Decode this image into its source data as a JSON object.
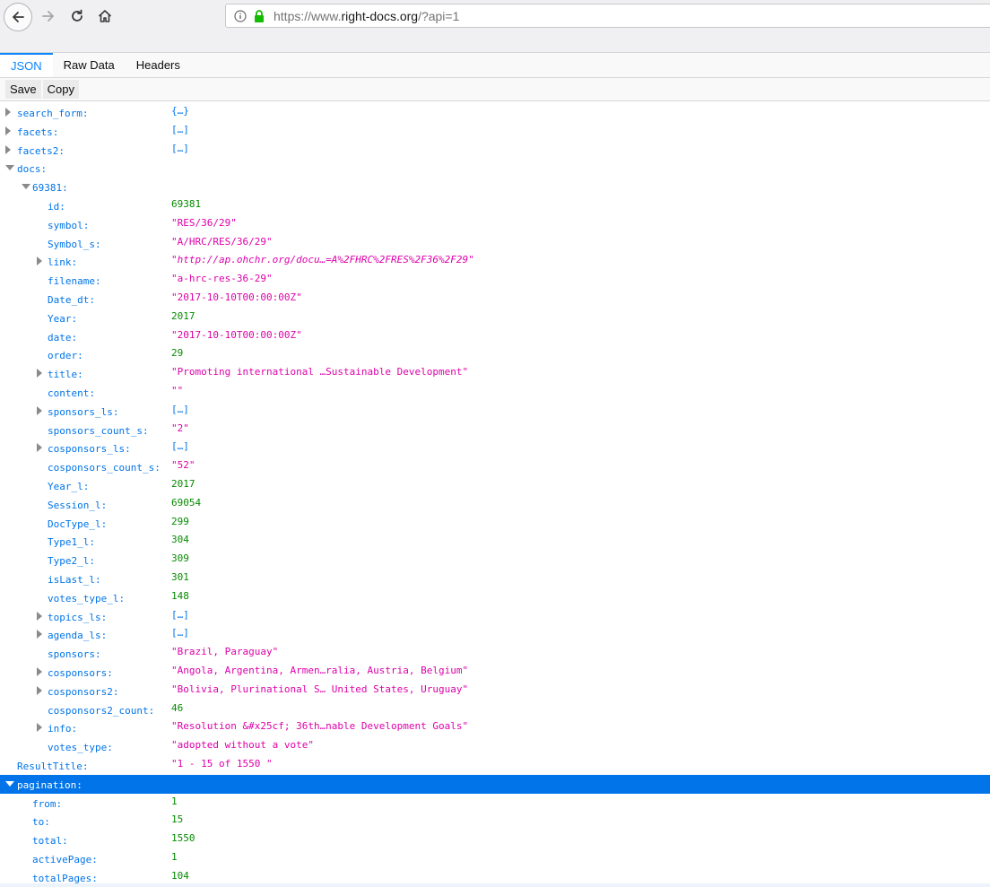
{
  "browser": {
    "url_prefix": "https://www.",
    "url_host": "right-docs.org",
    "url_suffix": "/?api=1"
  },
  "viewer": {
    "tabs": [
      "JSON",
      "Raw Data",
      "Headers"
    ],
    "active_tab": "JSON",
    "save_label": "Save",
    "copy_label": "Copy"
  },
  "tree": [
    {
      "key": "search_form:",
      "value": "{…}",
      "type": "obj",
      "indent": 0,
      "expander": "closed"
    },
    {
      "key": "facets:",
      "value": "[…]",
      "type": "obj",
      "indent": 0,
      "expander": "closed"
    },
    {
      "key": "facets2:",
      "value": "[…]",
      "type": "obj",
      "indent": 0,
      "expander": "closed"
    },
    {
      "key": "docs:",
      "value": "",
      "type": "obj",
      "indent": 0,
      "expander": "open"
    },
    {
      "key": "69381:",
      "value": "",
      "type": "obj",
      "indent": 1,
      "expander": "open"
    },
    {
      "key": "id:",
      "value": "69381",
      "type": "num",
      "indent": 2,
      "expander": "none"
    },
    {
      "key": "symbol:",
      "value": "\"RES/36/29\"",
      "type": "str",
      "indent": 2,
      "expander": "none"
    },
    {
      "key": "Symbol_s:",
      "value": "\"A/HRC/RES/36/29\"",
      "type": "str",
      "indent": 2,
      "expander": "none"
    },
    {
      "key": "link:",
      "value": "\"http://ap.ohchr.org/docu…=A%2FHRC%2FRES%2F36%2F29\"",
      "type": "link",
      "indent": 2,
      "expander": "closed"
    },
    {
      "key": "filename:",
      "value": "\"a-hrc-res-36-29\"",
      "type": "str",
      "indent": 2,
      "expander": "none"
    },
    {
      "key": "Date_dt:",
      "value": "\"2017-10-10T00:00:00Z\"",
      "type": "str",
      "indent": 2,
      "expander": "none"
    },
    {
      "key": "Year:",
      "value": "2017",
      "type": "num",
      "indent": 2,
      "expander": "none"
    },
    {
      "key": "date:",
      "value": "\"2017-10-10T00:00:00Z\"",
      "type": "str",
      "indent": 2,
      "expander": "none"
    },
    {
      "key": "order:",
      "value": "29",
      "type": "num",
      "indent": 2,
      "expander": "none"
    },
    {
      "key": "title:",
      "value": "\"Promoting international …Sustainable Development\"",
      "type": "str",
      "indent": 2,
      "expander": "closed"
    },
    {
      "key": "content:",
      "value": "\"\"",
      "type": "str",
      "indent": 2,
      "expander": "none"
    },
    {
      "key": "sponsors_ls:",
      "value": "[…]",
      "type": "obj",
      "indent": 2,
      "expander": "closed"
    },
    {
      "key": "sponsors_count_s:",
      "value": "\"2\"",
      "type": "str",
      "indent": 2,
      "expander": "none"
    },
    {
      "key": "cosponsors_ls:",
      "value": "[…]",
      "type": "obj",
      "indent": 2,
      "expander": "closed"
    },
    {
      "key": "cosponsors_count_s:",
      "value": "\"52\"",
      "type": "str",
      "indent": 2,
      "expander": "none"
    },
    {
      "key": "Year_l:",
      "value": "2017",
      "type": "num",
      "indent": 2,
      "expander": "none"
    },
    {
      "key": "Session_l:",
      "value": "69054",
      "type": "num",
      "indent": 2,
      "expander": "none"
    },
    {
      "key": "DocType_l:",
      "value": "299",
      "type": "num",
      "indent": 2,
      "expander": "none"
    },
    {
      "key": "Type1_l:",
      "value": "304",
      "type": "num",
      "indent": 2,
      "expander": "none"
    },
    {
      "key": "Type2_l:",
      "value": "309",
      "type": "num",
      "indent": 2,
      "expander": "none"
    },
    {
      "key": "isLast_l:",
      "value": "301",
      "type": "num",
      "indent": 2,
      "expander": "none"
    },
    {
      "key": "votes_type_l:",
      "value": "148",
      "type": "num",
      "indent": 2,
      "expander": "none"
    },
    {
      "key": "topics_ls:",
      "value": "[…]",
      "type": "obj",
      "indent": 2,
      "expander": "closed"
    },
    {
      "key": "agenda_ls:",
      "value": "[…]",
      "type": "obj",
      "indent": 2,
      "expander": "closed"
    },
    {
      "key": "sponsors:",
      "value": "\"Brazil, Paraguay\"",
      "type": "str",
      "indent": 2,
      "expander": "none"
    },
    {
      "key": "cosponsors:",
      "value": "\"Angola, Argentina, Armen…ralia, Austria, Belgium\"",
      "type": "str",
      "indent": 2,
      "expander": "closed"
    },
    {
      "key": "cosponsors2:",
      "value": "\"Bolivia, Plurinational S… United States, Uruguay\"",
      "type": "str",
      "indent": 2,
      "expander": "closed"
    },
    {
      "key": "cosponsors2_count:",
      "value": "46",
      "type": "num",
      "indent": 2,
      "expander": "none"
    },
    {
      "key": "info:",
      "value": "\"Resolution &#x25cf; 36th…nable Development Goals\"",
      "type": "str",
      "indent": 2,
      "expander": "closed"
    },
    {
      "key": "votes_type:",
      "value": "\"adopted without a vote\"",
      "type": "str",
      "indent": 2,
      "expander": "none"
    },
    {
      "key": "ResultTitle:",
      "value": "\"1 - 15 of 1550 \"",
      "type": "str",
      "indent": 0,
      "expander": "none"
    },
    {
      "key": "pagination:",
      "value": "",
      "type": "obj",
      "indent": 0,
      "expander": "open",
      "selected": true
    },
    {
      "key": "from:",
      "value": "1",
      "type": "num",
      "indent": 1,
      "expander": "none"
    },
    {
      "key": "to:",
      "value": "15",
      "type": "num",
      "indent": 1,
      "expander": "none"
    },
    {
      "key": "total:",
      "value": "1550",
      "type": "num",
      "indent": 1,
      "expander": "none"
    },
    {
      "key": "activePage:",
      "value": "1",
      "type": "num",
      "indent": 1,
      "expander": "none"
    },
    {
      "key": "totalPages:",
      "value": "104",
      "type": "num",
      "indent": 1,
      "expander": "none"
    }
  ]
}
